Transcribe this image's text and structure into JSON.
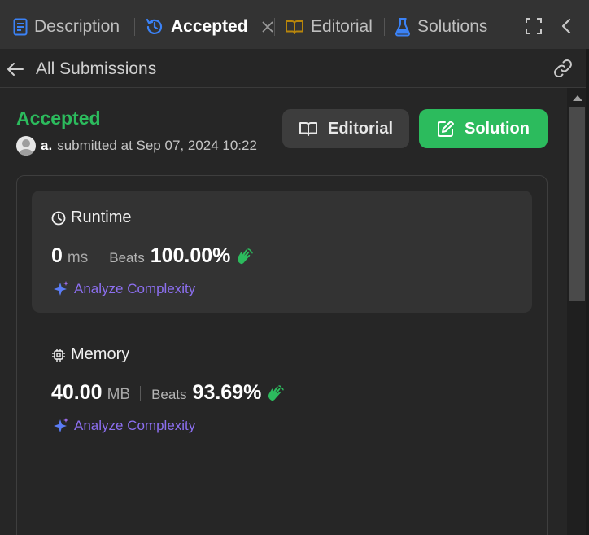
{
  "tabs": [
    {
      "label": "Description",
      "icon": "description-icon",
      "active": false
    },
    {
      "label": "Accepted",
      "icon": "history-icon",
      "active": true
    },
    {
      "label": "Editorial",
      "icon": "book-icon",
      "active": false
    },
    {
      "label": "Solutions",
      "icon": "flask-icon",
      "active": false
    }
  ],
  "subnav": {
    "back_label": "All Submissions"
  },
  "submission": {
    "status": "Accepted",
    "user": "a.",
    "submitted_text": "submitted at Sep 07, 2024 10:22"
  },
  "buttons": {
    "editorial": "Editorial",
    "solution": "Solution"
  },
  "runtime": {
    "title": "Runtime",
    "value": "0",
    "unit": "ms",
    "beats_label": "Beats",
    "beats_value": "100.00%",
    "analyze_label": "Analyze Complexity"
  },
  "memory": {
    "title": "Memory",
    "value": "40.00",
    "unit": "MB",
    "beats_label": "Beats",
    "beats_value": "93.69%",
    "analyze_label": "Analyze Complexity"
  },
  "colors": {
    "accent_green": "#2cbb5d",
    "tab_blue": "#3b82f6",
    "editorial_gold": "#b8860b",
    "flask_blue": "#3b82f6",
    "analyze_purple": "#8c6ff0"
  }
}
